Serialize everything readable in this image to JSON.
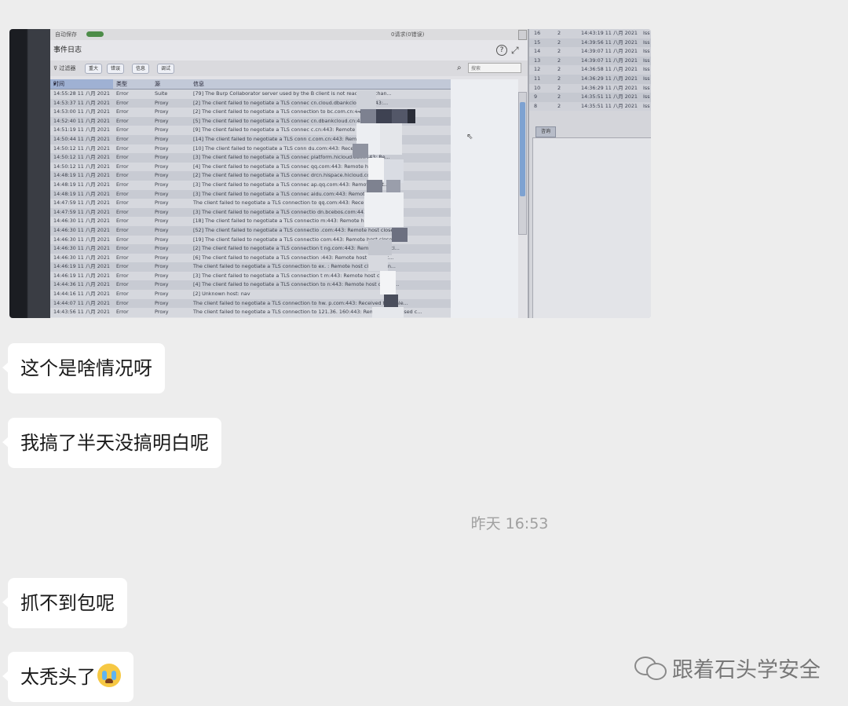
{
  "photo": {
    "top_strip": {
      "label": "自动保存",
      "count": "0请求(0错误)"
    },
    "panel_title": "事件日志",
    "help_icon": "?",
    "filter": {
      "label": "过滤器",
      "chips": [
        "重大",
        "错误",
        "信息",
        "调试"
      ],
      "search_placeholder": "搜索"
    },
    "columns": [
      "时间",
      "类型",
      "源",
      "信息"
    ],
    "rows": [
      [
        "14:55:28 11 八月 2021",
        "Error",
        "Suite",
        "[79] The Burp Collaborator server used by the B            client is not reachable, chan..."
      ],
      [
        "14:53:37 11 八月 2021",
        "Error",
        "Proxy",
        "[2] The client failed to negotiate a TLS connec             cn.cloud.dbankcloud.cn:443:..."
      ],
      [
        "14:53:00 11 八月 2021",
        "Error",
        "Proxy",
        "[2] The client failed to negotiate a TLS connection to        bc.com.cn:443: Remote hos..."
      ],
      [
        "14:52:40 11 八月 2021",
        "Error",
        "Proxy",
        "[5] The client failed to negotiate a TLS connec              cn.dbankcloud.cn:443: Re..."
      ],
      [
        "14:51:19 11 八月 2021",
        "Error",
        "Proxy",
        "[9] The client failed to negotiate a TLS connec              c.cn:443: Remote host close..."
      ],
      [
        "14:50:44 11 八月 2021",
        "Error",
        "Proxy",
        "[14] The client failed to negotiate a TLS conn              c.com.cn:443: Remote host..."
      ],
      [
        "14:50:12 11 八月 2021",
        "Error",
        "Proxy",
        "[10] The client failed to negotiate a TLS conn              du.com:443: Received fatal a..."
      ],
      [
        "14:50:12 11 八月 2021",
        "Error",
        "Proxy",
        "[3] The client failed to negotiate a TLS connec        platform.hicloud.com:443: Re..."
      ],
      [
        "14:50:12 11 八月 2021",
        "Error",
        "Proxy",
        "[4] The client failed to negotiate a TLS connec              qq.com:443: Remote host c..."
      ],
      [
        "14:48:19 11 八月 2021",
        "Error",
        "Proxy",
        "[2] The client failed to negotiate a TLS connec        drcn.hispace.hicloud.com:443..."
      ],
      [
        "14:48:19 11 八月 2021",
        "Error",
        "Proxy",
        "[3] The client failed to negotiate a TLS connec              ap.qq.com:443: Remote host..."
      ],
      [
        "14:48:19 11 八月 2021",
        "Error",
        "Proxy",
        "[3] The client failed to negotiate a TLS connec              aidu.com:443: Remote host c..."
      ],
      [
        "14:47:59 11 八月 2021",
        "Error",
        "Proxy",
        "The client failed to negotiate a TLS connection to            qq.com:443: Received fatal..."
      ],
      [
        "14:47:59 11 八月 2021",
        "Error",
        "Proxy",
        "[3] The client failed to negotiate a TLS connectio            dn.bcebos.com:443: Remot..."
      ],
      [
        "14:46:30 11 八月 2021",
        "Error",
        "Proxy",
        "[18] The client failed to negotiate a TLS connectio            m:443: Remote host closed..."
      ],
      [
        "14:46:30 11 八月 2021",
        "Error",
        "Proxy",
        "[52] The client failed to negotiate a TLS connectio           .com:443: Remote host close..."
      ],
      [
        "14:46:30 11 八月 2021",
        "Error",
        "Proxy",
        "[19] The client failed to negotiate a TLS connectio            com:443: Remote host closed..."
      ],
      [
        "14:46:30 11 八月 2021",
        "Error",
        "Proxy",
        "[2] The client failed to negotiate a TLS connection t         ng.com:443: Remote host cl..."
      ],
      [
        "14:46:30 11 八月 2021",
        "Error",
        "Proxy",
        "[6] The client failed to negotiate a TLS connection            :443: Remote host closed c..."
      ],
      [
        "14:46:19 11 八月 2021",
        "Error",
        "Proxy",
        "The client failed to negotiate a TLS connection to ex.            : Remote host closed con..."
      ],
      [
        "14:46:19 11 八月 2021",
        "Error",
        "Proxy",
        "[3] The client failed to negotiate a TLS connection t            m:443: Remote host close..."
      ],
      [
        "14:44:36 11 八月 2021",
        "Error",
        "Proxy",
        "[4] The client failed to negotiate a TLS connection to            n:443: Remote host closed..."
      ],
      [
        "14:44:16 11 八月 2021",
        "Error",
        "Proxy",
        "[2] Unknown host: nav"
      ],
      [
        "14:44:07 11 八月 2021",
        "Error",
        "Proxy",
        "The client failed to negotiate a TLS connection to hw.           p.com:443: Received fatal ale..."
      ],
      [
        "14:43:56 11 八月 2021",
        "Error",
        "Proxy",
        "The client failed to negotiate a TLS connection to 121.36.         160:443: Remote host closed c..."
      ]
    ],
    "right_rows": [
      [
        "16",
        "2",
        "14:43:19 11 八月 2021",
        "Iss"
      ],
      [
        "15",
        "2",
        "14:39:56 11 八月 2021",
        "Iss"
      ],
      [
        "14",
        "2",
        "14:39:07 11 八月 2021",
        "Iss"
      ],
      [
        "13",
        "2",
        "14:39:07 11 八月 2021",
        "Iss"
      ],
      [
        "12",
        "2",
        "14:36:58 11 八月 2021",
        "Iss"
      ],
      [
        "11",
        "2",
        "14:36:29 11 八月 2021",
        "Iss"
      ],
      [
        "10",
        "2",
        "14:36:29 11 八月 2021",
        "Iss"
      ],
      [
        "9",
        "2",
        "14:35:51 11 八月 2021",
        "Iss"
      ],
      [
        "8",
        "2",
        "14:35:51 11 八月 2021",
        "Iss"
      ]
    ],
    "right_tab": "咨询"
  },
  "messages": [
    {
      "text": "这个是啥情况呀"
    },
    {
      "text": "我搞了半天没搞明白呢"
    },
    {
      "text": "抓不到包呢"
    },
    {
      "text": "太秃头了"
    }
  ],
  "timestamp": "昨天 16:53",
  "watermark": {
    "text": "跟着石头学安全",
    "icon": "wechat-icon"
  },
  "colors": {
    "background": "#ededed",
    "bubble": "#ffffff",
    "timestamp": "#a0a0a0"
  }
}
